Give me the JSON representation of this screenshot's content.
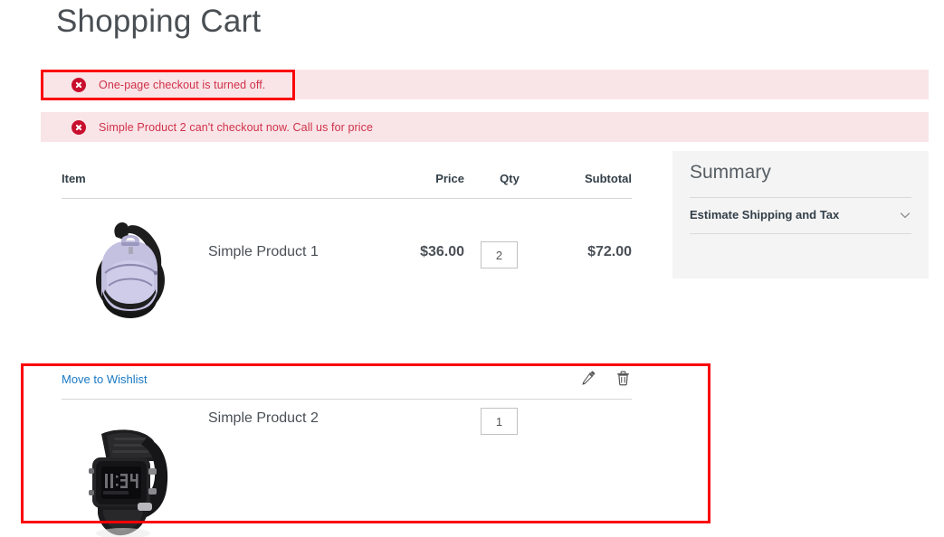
{
  "page": {
    "title": "Shopping Cart"
  },
  "messages": [
    {
      "icon": "error-circle-icon",
      "text": "One-page checkout is turned off."
    },
    {
      "icon": "error-circle-icon",
      "text": "Simple Product 2 can't checkout now. Call us for price"
    }
  ],
  "cart": {
    "columns": {
      "item": "Item",
      "price": "Price",
      "qty": "Qty",
      "subtotal": "Subtotal"
    },
    "items": [
      {
        "name": "Simple Product 1",
        "image_alt": "lavender-backpack-image",
        "price": "$36.00",
        "qty": "2",
        "subtotal": "$72.00"
      },
      {
        "name": "Simple Product 2",
        "image_alt": "black-digital-watch-image",
        "price": "",
        "qty": "1",
        "subtotal": "",
        "wishlist_label": "Move to Wishlist",
        "edit_icon": "pencil-icon",
        "remove_icon": "trash-icon"
      }
    ]
  },
  "summary": {
    "title": "Summary",
    "shipping_row_label": "Estimate Shipping and Tax",
    "chevron_icon": "chevron-down-icon"
  },
  "colors": {
    "error_bg": "#f9e5e7",
    "error_text": "#d0304a",
    "error_icon": "#c8102e",
    "annotation": "#fb0007",
    "link": "#1979c3",
    "summary_bg": "#f4f4f4",
    "text": "#4a5056"
  }
}
